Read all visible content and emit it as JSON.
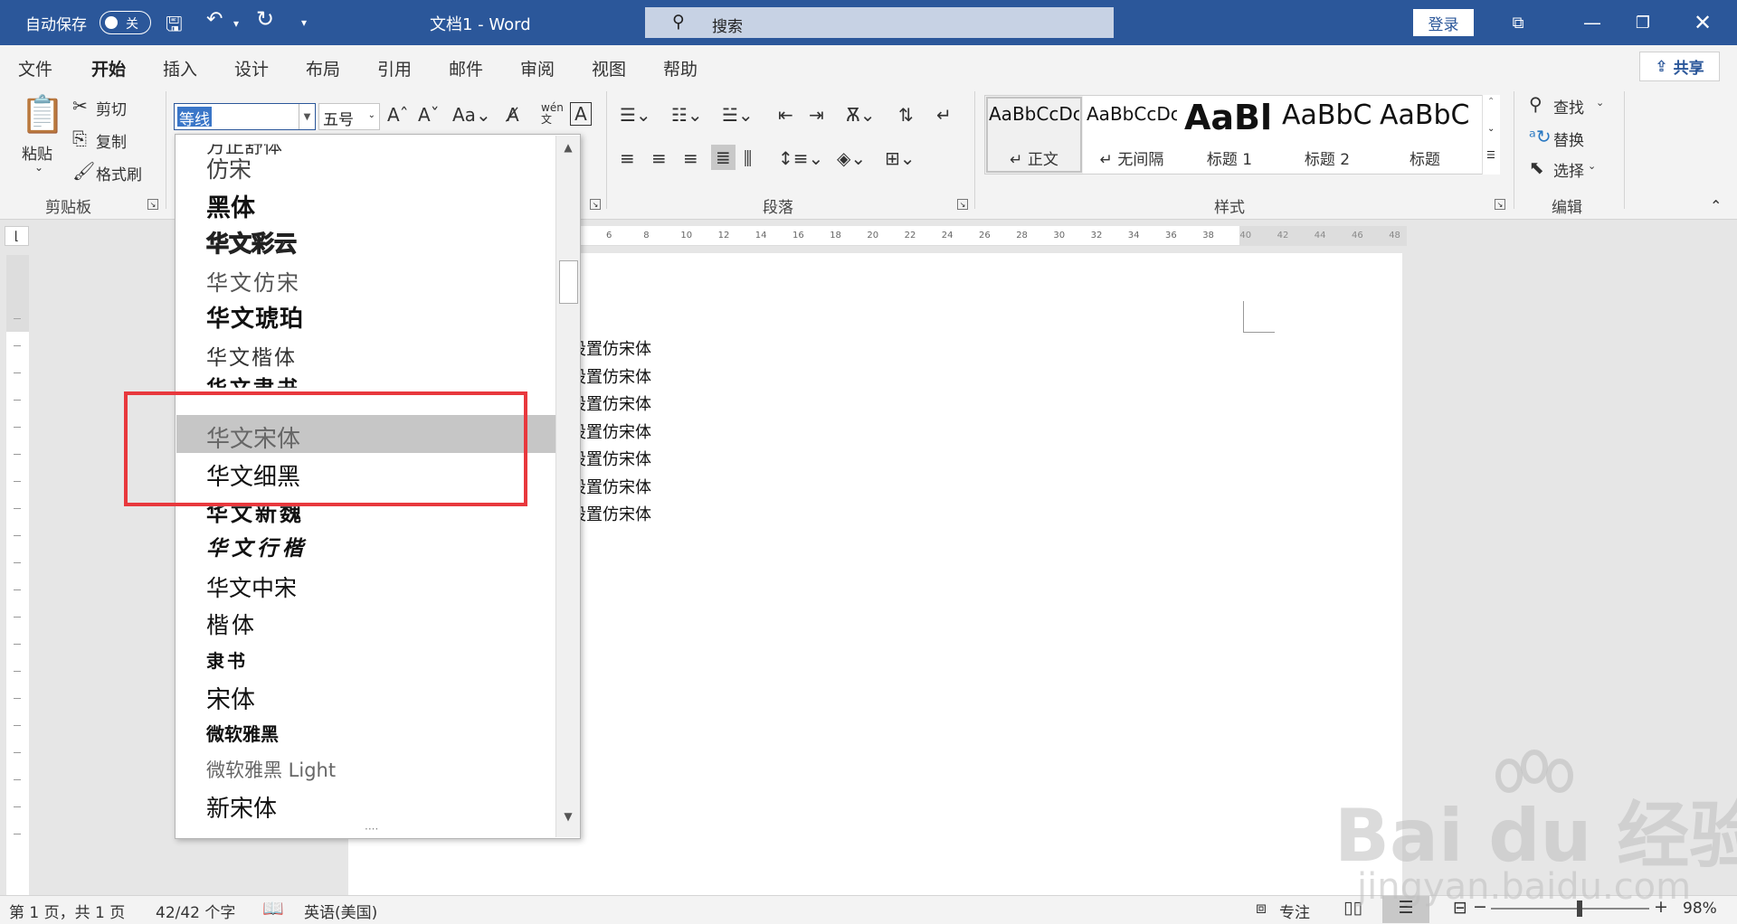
{
  "titlebar": {
    "autosave_label": "自动保存",
    "autosave_state": "关",
    "doc_title": "文档1 - Word",
    "search_placeholder": "搜索",
    "login": "登录"
  },
  "tabs": [
    "文件",
    "开始",
    "插入",
    "设计",
    "布局",
    "引用",
    "邮件",
    "审阅",
    "视图",
    "帮助"
  ],
  "share": "共享",
  "clipboard": {
    "paste": "粘贴",
    "cut": "剪切",
    "copy": "复制",
    "format_painter": "格式刷",
    "label": "剪贴板"
  },
  "font": {
    "name": "等线",
    "size": "五号"
  },
  "paragraph": {
    "label": "段落"
  },
  "styles": {
    "label": "样式",
    "items": [
      {
        "preview": "AaBbCcDc",
        "name": "↵ 正文"
      },
      {
        "preview": "AaBbCcDc",
        "name": "↵ 无间隔"
      },
      {
        "preview": "AaBl",
        "name": "标题 1"
      },
      {
        "preview": "AaBbC",
        "name": "标题 2"
      },
      {
        "preview": "AaBbC",
        "name": "标题"
      }
    ]
  },
  "editing": {
    "find": "查找",
    "replace": "替换",
    "select": "选择",
    "label": "编辑"
  },
  "font_list": [
    "方正舒体",
    "仿宋",
    "黑体",
    "华文彩云",
    "华文仿宋",
    "华文琥珀",
    "华文楷体",
    "华文隶书",
    "华文宋体",
    "华文细黑",
    "华文新魏",
    "华文行楷",
    "华文中宋",
    "楷体",
    "隶书",
    "宋体",
    "微软雅黑",
    "微软雅黑 Light",
    "新宋体"
  ],
  "document": {
    "lines": [
      "设置仿宋体",
      "设置仿宋体",
      "设置仿宋体",
      "设置仿宋体",
      "设置仿宋体",
      "设置仿宋体",
      "设置仿宋体"
    ]
  },
  "ruler": {
    "ticks": [
      "6",
      "8",
      "10",
      "12",
      "14",
      "16",
      "18",
      "20",
      "22",
      "24",
      "26",
      "28",
      "30",
      "32",
      "34",
      "36",
      "38",
      "40",
      "42",
      "44",
      "46",
      "48"
    ]
  },
  "status": {
    "page": "第 1 页，共 1 页",
    "words": "42/42 个字",
    "language": "英语(美国)",
    "focus": "专注",
    "zoom": "98%"
  },
  "watermark": {
    "brand": "Bai du 经验",
    "url": "jingyan.baidu.com"
  },
  "colors": {
    "accent": "#2b579a",
    "highlight_box": "#e8383d"
  }
}
